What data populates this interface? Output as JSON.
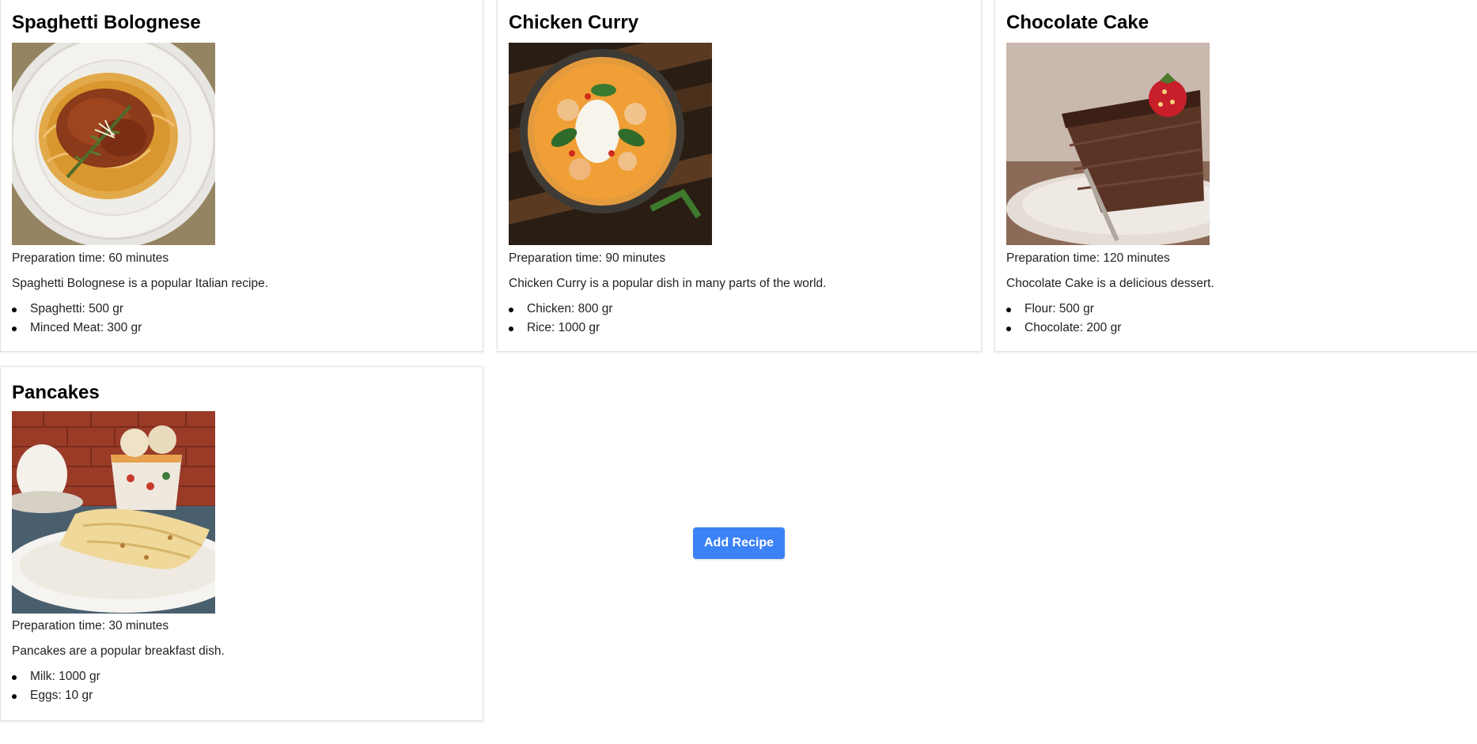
{
  "recipes": [
    {
      "title": "Spaghetti Bolognese",
      "image_alt": "spaghetti-bolognese-photo",
      "prep": "Preparation time: 60 minutes",
      "description": "Spaghetti Bolognese is a popular Italian recipe.",
      "ingredients": [
        "Spaghetti: 500 gr",
        "Minced Meat: 300 gr"
      ]
    },
    {
      "title": "Chicken Curry",
      "image_alt": "chicken-curry-photo",
      "prep": "Preparation time: 90 minutes",
      "description": "Chicken Curry is a popular dish in many parts of the world.",
      "ingredients": [
        "Chicken: 800 gr",
        "Rice: 1000 gr"
      ]
    },
    {
      "title": "Chocolate Cake",
      "image_alt": "chocolate-cake-photo",
      "prep": "Preparation time: 120 minutes",
      "description": "Chocolate Cake is a delicious dessert.",
      "ingredients": [
        "Flour: 500 gr",
        "Chocolate: 200 gr"
      ]
    },
    {
      "title": "Pancakes",
      "image_alt": "pancakes-photo",
      "prep": "Preparation time: 30 minutes",
      "description": "Pancakes are a popular breakfast dish.",
      "ingredients": [
        "Milk: 1000 gr",
        "Eggs: 10 gr"
      ]
    }
  ],
  "add_button": {
    "label": "Add Recipe"
  },
  "colors": {
    "accent": "#3b82f6",
    "card_border": "#e2e2e2",
    "text": "#222222",
    "title": "#000000"
  }
}
